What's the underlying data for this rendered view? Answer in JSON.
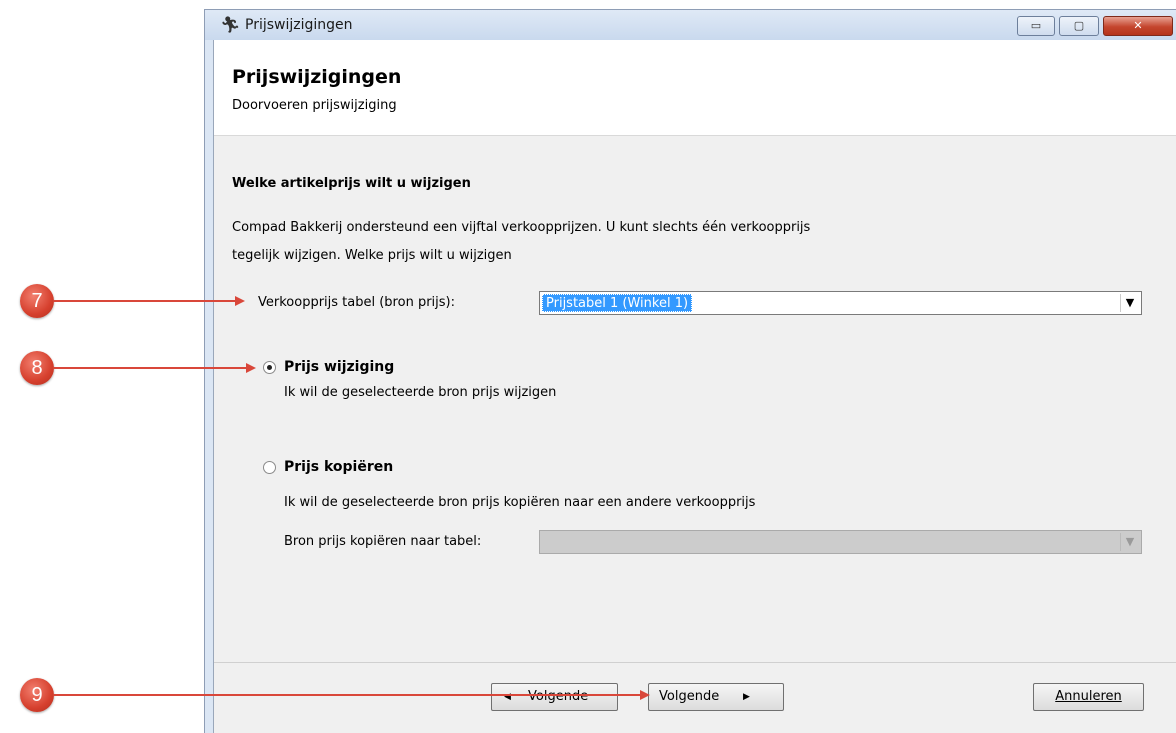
{
  "window": {
    "title": "Prijswijzigingen",
    "app_icon": "runner-icon",
    "minimize_glyph": "▭",
    "maximize_glyph": "▢",
    "close_glyph": "✕"
  },
  "header": {
    "title": "Prijswijzigingen",
    "subtitle": "Doorvoeren prijswijziging"
  },
  "question": {
    "title": "Welke artikelprijs wilt u wijzigen",
    "intro_line1": "Compad Bakkerij ondersteund een vijftal verkoopprijzen. U kunt slechts één verkoopprijs",
    "intro_line2": "tegelijk wijzigen. Welke prijs wilt u wijzigen"
  },
  "source_price": {
    "label": "Verkoopprijs tabel (bron prijs):",
    "value": "Prijstabel 1 (Winkel 1)"
  },
  "options": [
    {
      "label": "Prijs wijziging",
      "description": "Ik wil de geselecteerde bron prijs wijzigen",
      "selected": true
    },
    {
      "label": "Prijs kopiëren",
      "description": "Ik wil de geselecteerde bron prijs kopiëren naar een andere verkoopprijs",
      "selected": false
    }
  ],
  "copy_target": {
    "label": "Bron prijs kopiëren naar tabel:",
    "value": ""
  },
  "footer": {
    "back_label": "Volgende",
    "next_label": "Volgende",
    "cancel_label": "Annuleren"
  },
  "annotations": [
    "7",
    "8",
    "9"
  ],
  "colors": {
    "annotation": "#d9473a",
    "selection": "#3399ff"
  }
}
